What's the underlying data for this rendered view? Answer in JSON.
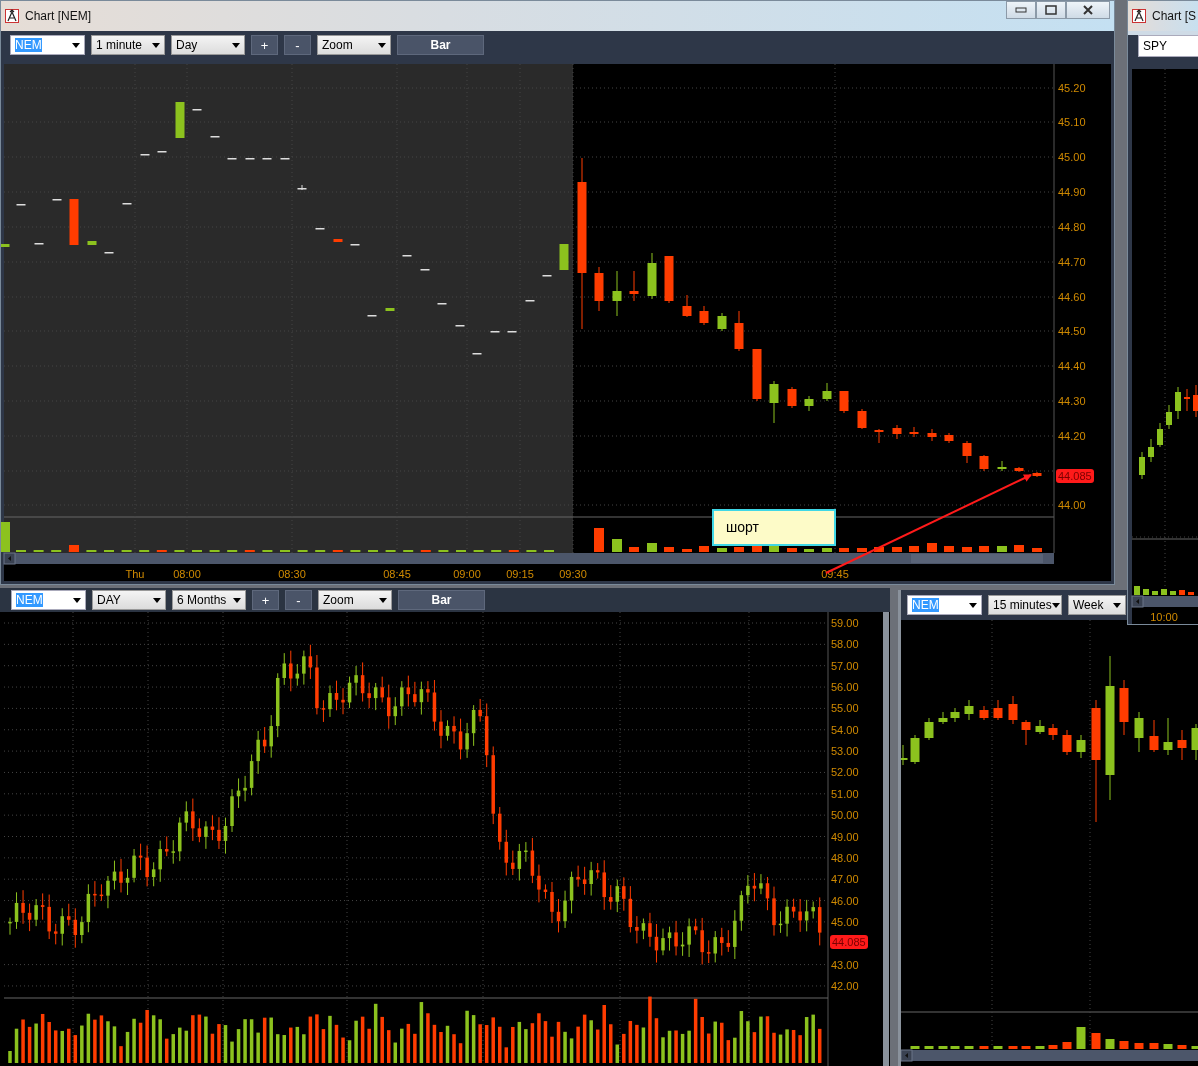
{
  "main_window": {
    "title": "Chart [NEM]",
    "toolbar": [
      {
        "kind": "field",
        "text": "NEM"
      },
      {
        "kind": "dropdown",
        "text": "1 minute"
      },
      {
        "kind": "dropdown",
        "text": "Day"
      },
      {
        "kind": "button",
        "text": "+"
      },
      {
        "kind": "button",
        "text": "-"
      },
      {
        "kind": "dropdown",
        "text": "Zoom"
      },
      {
        "kind": "mode",
        "text": "Bar"
      }
    ],
    "price_labels": [
      "45.20",
      "45.10",
      "45.00",
      "44.90",
      "44.80",
      "44.70",
      "44.60",
      "44.50",
      "44.40",
      "44.30",
      "44.20",
      "44.00"
    ],
    "last_price": "44.085",
    "time_labels": [
      "Thu",
      "08:00",
      "08:30",
      "08:45",
      "09:00",
      "09:15",
      "09:30",
      "09:45"
    ],
    "note": "шорт"
  },
  "spy_window": {
    "title": "Chart [S",
    "symbol": "SPY",
    "time_labels": [
      "10:00"
    ]
  },
  "daily_chart": {
    "toolbar": [
      {
        "kind": "field",
        "text": "NEM"
      },
      {
        "kind": "dropdown",
        "text": "DAY"
      },
      {
        "kind": "dropdown",
        "text": "6 Months"
      },
      {
        "kind": "button",
        "text": "+"
      },
      {
        "kind": "button",
        "text": "-"
      },
      {
        "kind": "dropdown",
        "text": "Zoom"
      },
      {
        "kind": "mode",
        "text": "Bar"
      }
    ],
    "price_labels": [
      "59.00",
      "58.00",
      "57.00",
      "56.00",
      "55.00",
      "54.00",
      "53.00",
      "52.00",
      "51.00",
      "50.00",
      "49.00",
      "48.00",
      "47.00",
      "46.00",
      "45.00",
      "43.00",
      "42.00"
    ],
    "last_price": "44.085"
  },
  "intraday_chart": {
    "toolbar": [
      {
        "kind": "field",
        "text": "NEM"
      },
      {
        "kind": "dropdown",
        "text": "15 minutes"
      },
      {
        "kind": "dropdown",
        "text": "Week"
      }
    ]
  }
}
